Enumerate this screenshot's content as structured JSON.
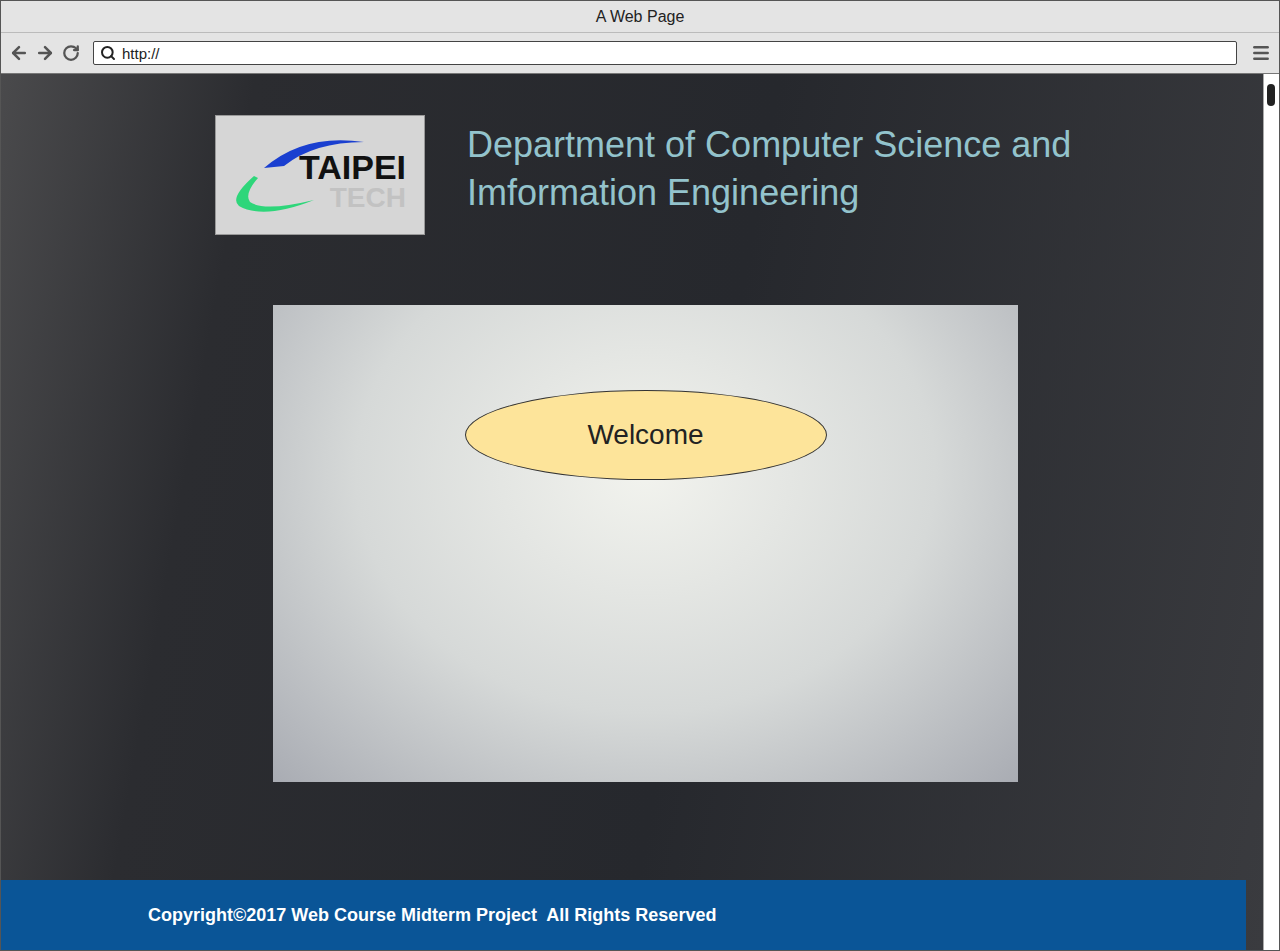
{
  "window": {
    "title": "A Web Page"
  },
  "address_bar": {
    "value": "http://"
  },
  "logo": {
    "primary": "TAIPEI",
    "secondary": "TECH"
  },
  "header": {
    "title": "Department of Computer Science and Imformation Engineering"
  },
  "hero": {
    "button": "Welcome"
  },
  "footer": {
    "text": "Copyright©2017 Web Course Midterm Project  All Rights Reserved"
  }
}
